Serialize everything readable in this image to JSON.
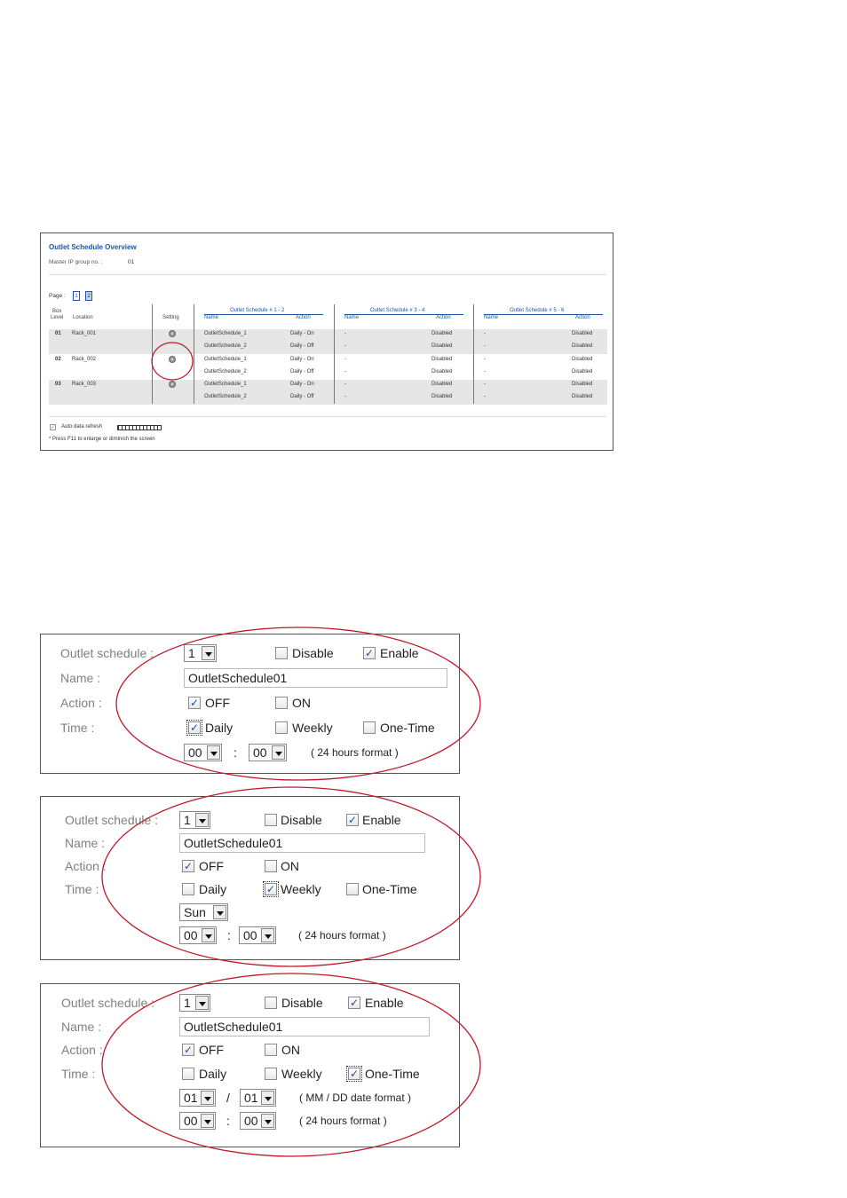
{
  "overview": {
    "title": "Outlet  Schedule  Overview",
    "master_label": "Master  IP  group no. :",
    "master_value": "01",
    "page_label": "Page :",
    "pages": [
      "1",
      "2"
    ],
    "headers": {
      "box_level": "Box\nLevel",
      "box": "Box",
      "level": "Level",
      "location": "Location",
      "setting": "Setting",
      "group1": "Outlet Schedule # 1 - 2",
      "group2": "Outlet Schedule # 3 - 4",
      "group3": "Outlet Schedule # 5 - 6",
      "name": "Name",
      "action": "Action"
    },
    "rows": [
      {
        "level": "01",
        "location": "Rack_001",
        "sched": [
          [
            "OutletSchedule_1",
            "Daily - On"
          ],
          [
            "OutletSchedule_2",
            "Daily - Off"
          ]
        ]
      },
      {
        "level": "02",
        "location": "Rack_002",
        "sched": [
          [
            "OutletSchedule_1",
            "Daily - On"
          ],
          [
            "OutletSchedule_2",
            "Daily - Off"
          ]
        ]
      },
      {
        "level": "03",
        "location": "Rack_003",
        "sched": [
          [
            "OutletSchedule_1",
            "Daily - On"
          ],
          [
            "OutletSchedule_2",
            "Daily - Off"
          ]
        ]
      }
    ],
    "dash": "-",
    "disabled": "Disabled",
    "auto_refresh": "Auto data refresh",
    "footnote": "* Press F11 to enlarge or diminish the screen"
  },
  "form_labels": {
    "outlet_schedule": "Outlet schedule :",
    "name": "Name :",
    "action": "Action :",
    "time": "Time :",
    "disable": "Disable",
    "enable": "Enable",
    "off": "OFF",
    "on": "ON",
    "daily": "Daily",
    "weekly": "Weekly",
    "one_time": "One-Time",
    "colon": ":",
    "slash": "/",
    "hours_format": "( 24 hours format )",
    "date_format": "( MM / DD  date format )"
  },
  "forms": [
    {
      "schedule_no": "1",
      "name_value": "OutletSchedule01",
      "hour": "00",
      "minute": "00",
      "mode": "daily"
    },
    {
      "schedule_no": "1",
      "name_value": "OutletSchedule01",
      "weekday": "Sun",
      "hour": "00",
      "minute": "00",
      "mode": "weekly"
    },
    {
      "schedule_no": "1",
      "name_value": "OutletSchedule01",
      "month": "01",
      "day": "01",
      "hour": "00",
      "minute": "00",
      "mode": "one-time"
    }
  ],
  "colors": {
    "accent_blue": "#1a56a6",
    "highlight_red": "#c0182a",
    "row_gray": "#e6e6e6"
  },
  "icons": {
    "setting": "gear-icon",
    "dropdown": "chevron-down-icon",
    "checkbox": "checkbox-icon"
  }
}
